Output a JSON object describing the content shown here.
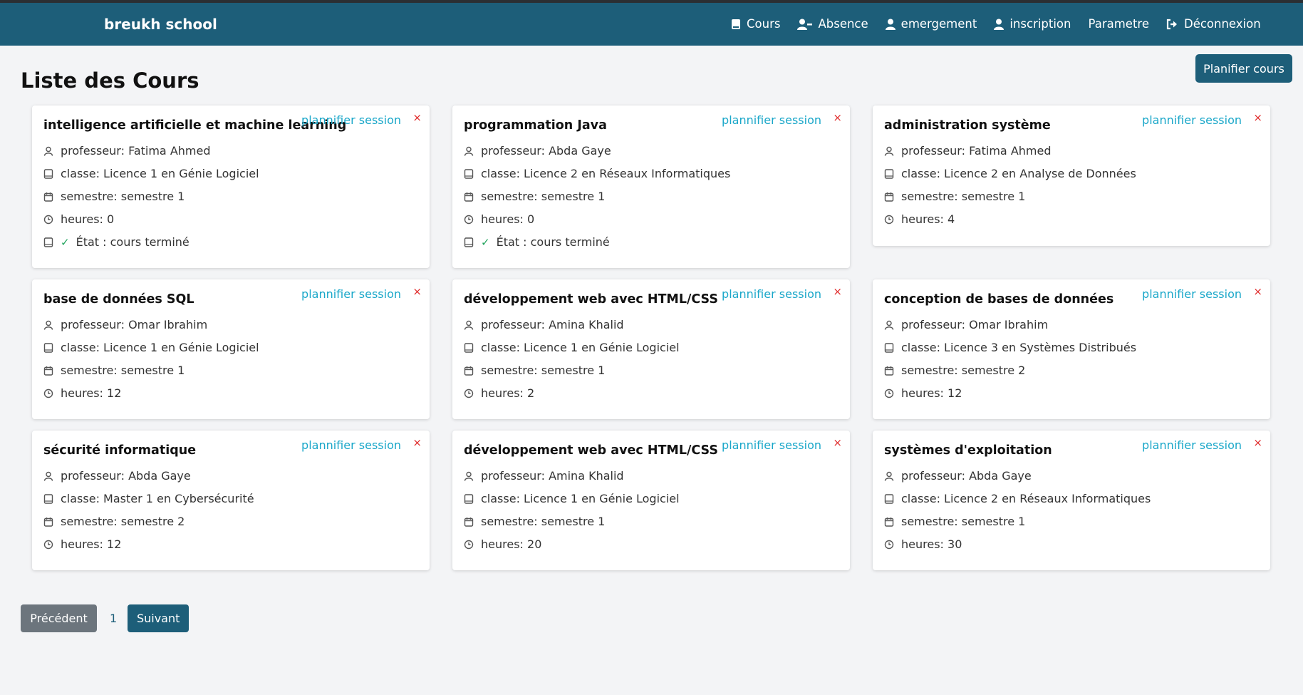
{
  "nav": {
    "brand": "breukh school",
    "items": [
      {
        "label": "Cours",
        "icon": "book-icon"
      },
      {
        "label": "Absence",
        "icon": "user-minus-icon"
      },
      {
        "label": "emergement",
        "icon": "user-icon"
      },
      {
        "label": "inscription",
        "icon": "user-icon"
      },
      {
        "label": "Parametre",
        "icon": ""
      },
      {
        "label": "Déconnexion",
        "icon": "logout-icon"
      }
    ]
  },
  "page": {
    "title": "Liste des Cours",
    "plan_button": "Planifier cours"
  },
  "cards": [
    {
      "title": "intelligence artificielle et machine learning",
      "link": "plannifier session",
      "close": "×",
      "prof": "professeur: Fatima Ahmed",
      "classe": "classe: Licence 1 en Génie Logiciel",
      "semestre": "semestre: semestre 1",
      "heures": "heures: 0",
      "etat": "État : cours terminé"
    },
    {
      "title": "programmation Java",
      "link": "plannifier session",
      "close": "×",
      "prof": "professeur: Abda Gaye",
      "classe": "classe: Licence 2 en Réseaux Informatiques",
      "semestre": "semestre: semestre 1",
      "heures": "heures: 0",
      "etat": "État : cours terminé"
    },
    {
      "title": "administration système",
      "link": "plannifier session",
      "close": "×",
      "prof": "professeur: Fatima Ahmed",
      "classe": "classe: Licence 2 en Analyse de Données",
      "semestre": "semestre: semestre 1",
      "heures": "heures: 4"
    },
    {
      "title": "base de données SQL",
      "link": "plannifier session",
      "close": "×",
      "prof": "professeur: Omar Ibrahim",
      "classe": "classe: Licence 1 en Génie Logiciel",
      "semestre": "semestre: semestre 1",
      "heures": "heures: 12"
    },
    {
      "title": "développement web avec HTML/CSS",
      "link": "plannifier session",
      "close": "×",
      "prof": "professeur: Amina Khalid",
      "classe": "classe: Licence 1 en Génie Logiciel",
      "semestre": "semestre: semestre 1",
      "heures": "heures: 2"
    },
    {
      "title": "conception de bases de données",
      "link": "plannifier session",
      "close": "×",
      "prof": "professeur: Omar Ibrahim",
      "classe": "classe: Licence 3 en Systèmes Distribués",
      "semestre": "semestre: semestre 2",
      "heures": "heures: 12"
    },
    {
      "title": "sécurité informatique",
      "link": "plannifier session",
      "close": "×",
      "prof": "professeur: Abda Gaye",
      "classe": "classe: Master 1 en Cybersécurité",
      "semestre": "semestre: semestre 2",
      "heures": "heures: 12"
    },
    {
      "title": "développement web avec HTML/CSS",
      "link": "plannifier session",
      "close": "×",
      "prof": "professeur: Amina Khalid",
      "classe": "classe: Licence 1 en Génie Logiciel",
      "semestre": "semestre: semestre 1",
      "heures": "heures: 20"
    },
    {
      "title": "systèmes d'exploitation",
      "link": "plannifier session",
      "close": "×",
      "prof": "professeur: Abda Gaye",
      "classe": "classe: Licence 2 en Réseaux Informatiques",
      "semestre": "semestre: semestre 1",
      "heures": "heures: 30"
    }
  ],
  "pagination": {
    "prev": "Précédent",
    "current": "1",
    "next": "Suivant"
  },
  "colors": {
    "navbar": "#1d5e79",
    "link": "#1aa7c9",
    "close": "#e02b2b",
    "check": "#22a45d",
    "prev_button": "#6c757d"
  }
}
